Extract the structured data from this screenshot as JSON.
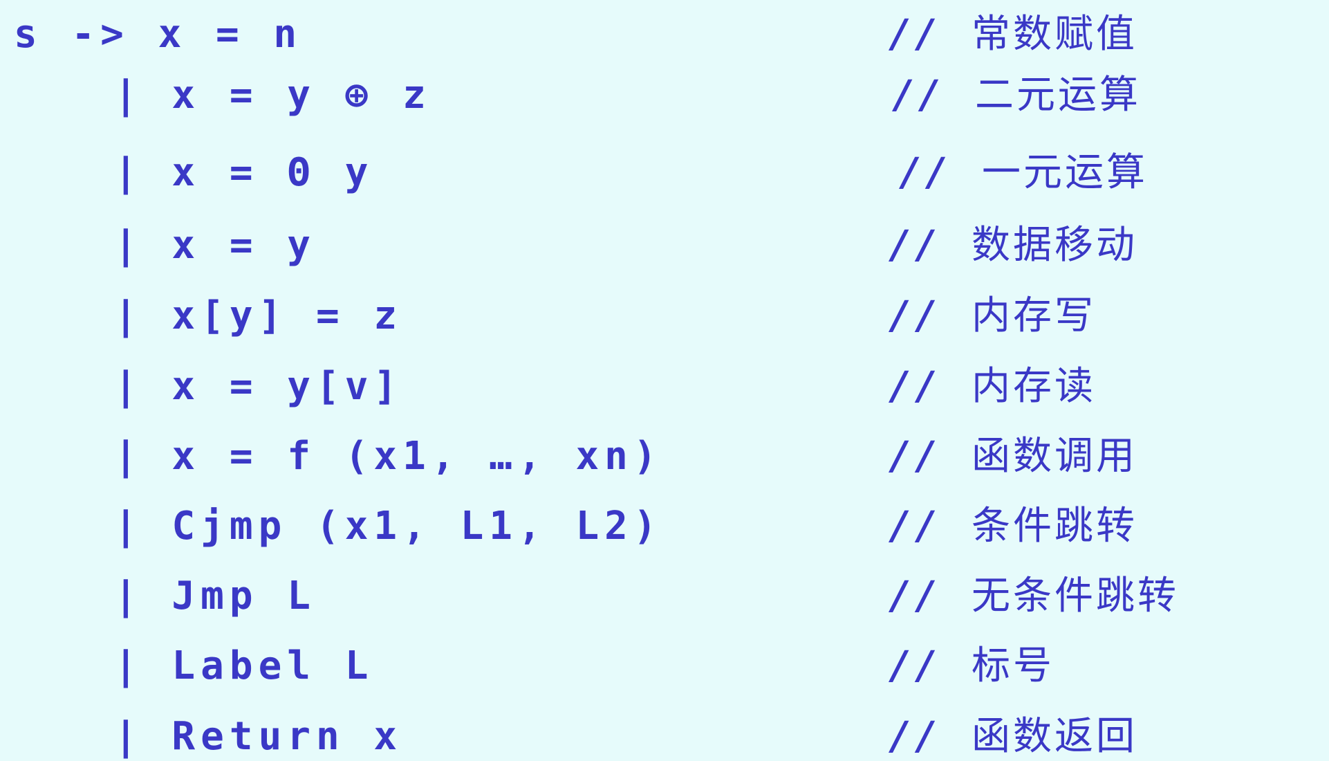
{
  "grammar": {
    "rows": [
      {
        "code": "s -> x = n",
        "comment_prefix": "//",
        "comment": "常数赋值"
      },
      {
        "code": "| x = y ⊕ z",
        "comment_prefix": "//",
        "comment": "二元运算"
      },
      {
        "code": "| x = Θ y",
        "comment_prefix": "//",
        "comment": "一元运算"
      },
      {
        "code": "| x = y",
        "comment_prefix": "//",
        "comment": "数据移动"
      },
      {
        "code": "| x[y] = z",
        "comment_prefix": "//",
        "comment": "内存写"
      },
      {
        "code": "| x = y[v]",
        "comment_prefix": "//",
        "comment": "内存读"
      },
      {
        "code": "| x = f (x1, …, xn)",
        "comment_prefix": "//",
        "comment": "函数调用"
      },
      {
        "code": "| Cjmp (x1, L1, L2)",
        "comment_prefix": "//",
        "comment": "条件跳转"
      },
      {
        "code": "| Jmp L",
        "comment_prefix": "//",
        "comment": "无条件跳转"
      },
      {
        "code": "| Label L",
        "comment_prefix": "//",
        "comment": "标号"
      },
      {
        "code": "| Return x",
        "comment_prefix": "//",
        "comment": "函数返回"
      }
    ]
  },
  "colors": {
    "background": "#e6fbfb",
    "text": "#3a38c6"
  }
}
